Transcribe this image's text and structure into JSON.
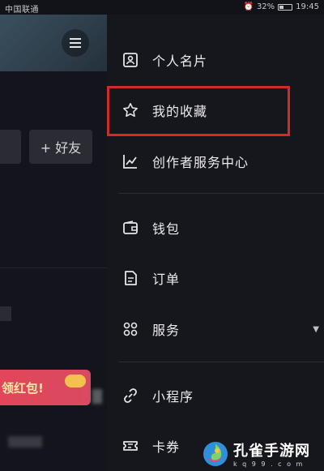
{
  "status_bar": {
    "carrier": "中国联通",
    "battery_percent": "32%",
    "time": "19:45"
  },
  "left_pane": {
    "add_friend_label": "+ 好友",
    "promo_text": "领红包!"
  },
  "drawer": {
    "items": [
      {
        "label": "个人名片",
        "icon": "profile-card-icon"
      },
      {
        "label": "我的收藏",
        "icon": "star-icon"
      },
      {
        "label": "创作者服务中心",
        "icon": "line-chart-icon"
      },
      {
        "label": "钱包",
        "icon": "wallet-icon"
      },
      {
        "label": "订单",
        "icon": "order-icon"
      },
      {
        "label": "服务",
        "icon": "services-grid-icon"
      },
      {
        "label": "小程序",
        "icon": "mini-program-icon"
      },
      {
        "label": "卡券",
        "icon": "coupon-icon"
      }
    ],
    "highlight_color": "#d22a2a"
  },
  "watermark": {
    "title": "孔雀手游网",
    "subtitle": "k q 9 9 . c o m"
  }
}
